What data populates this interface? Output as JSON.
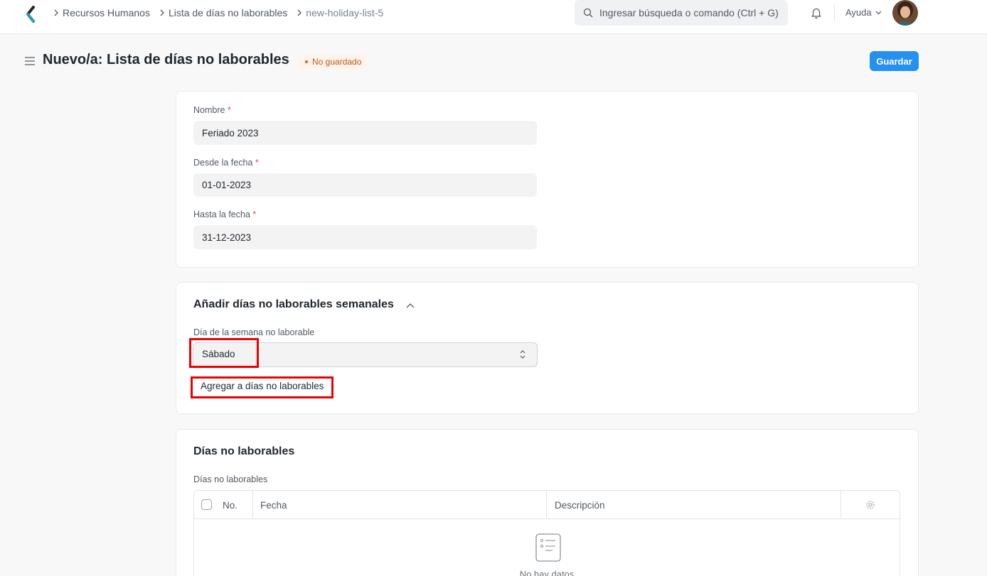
{
  "navbar": {
    "breadcrumbs": [
      "Recursos Humanos",
      "Lista de días no laborables",
      "new-holiday-list-5"
    ],
    "search_placeholder": "Ingresar búsqueda o comando (Ctrl + G)",
    "help_label": "Ayuda"
  },
  "page": {
    "title": "Nuevo/a: Lista de días no laborables",
    "status_badge": "No guardado",
    "save_label": "Guardar"
  },
  "form": {
    "nombre_label": "Nombre",
    "nombre_value": "Feriado 2023",
    "desde_label": "Desde la fecha",
    "desde_value": "01-01-2023",
    "hasta_label": "Hasta la fecha",
    "hasta_value": "31-12-2023",
    "required_mark": "*"
  },
  "weekly_section": {
    "title": "Añadir días no laborables semanales",
    "weekday_label": "Día de la semana no laborable",
    "weekday_value": "Sábado",
    "add_button_label": "Agregar a días no laborables"
  },
  "holidays_section": {
    "title": "Días no laborables",
    "table_label": "Días no laborables",
    "columns": [
      "No.",
      "Fecha",
      "Descripción"
    ],
    "empty_text": "No hay datos"
  },
  "colors": {
    "primary": "#2490ef",
    "highlight": "#ee0000",
    "badge_text": "#c0581f",
    "badge_bg": "#fff4ec"
  }
}
